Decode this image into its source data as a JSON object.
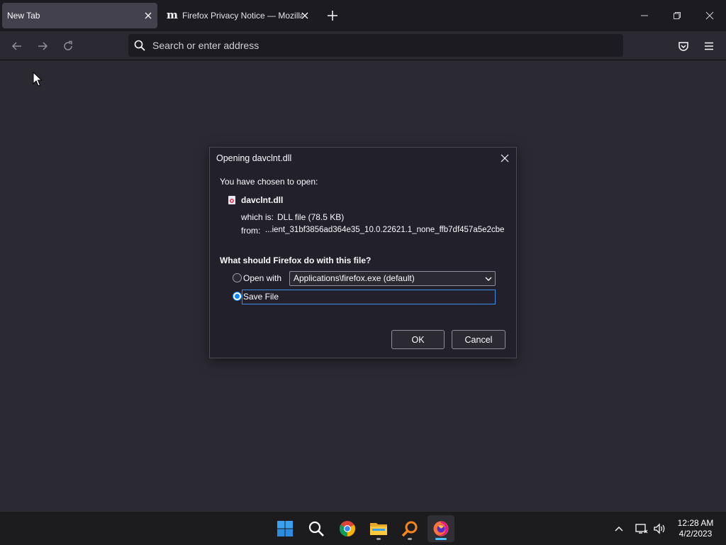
{
  "tabs": [
    {
      "label": "New Tab",
      "active": true
    },
    {
      "label": "Firefox Privacy Notice — Mozilla",
      "active": false,
      "favicon": "m"
    }
  ],
  "urlbar": {
    "placeholder": "Search or enter address"
  },
  "dialog": {
    "title": "Opening davclnt.dll",
    "chosen_text": "You have chosen to open:",
    "filename": "davclnt.dll",
    "which_is_label": "which is:",
    "which_is_value": "DLL file (78.5 KB)",
    "from_label": "from:",
    "from_value": "...ient_31bf3856ad364e35_10.0.22621.1_none_ffb7df457a5e2cbe",
    "question": "What should Firefox do with this file?",
    "open_with_label": "Open with",
    "open_with_app": "Applications\\firefox.exe (default)",
    "save_file_label": "Save File",
    "selected_option": "save_file",
    "ok_label": "OK",
    "cancel_label": "Cancel"
  },
  "taskbar": {
    "apps": [
      "windows-start",
      "search",
      "chrome",
      "file-explorer",
      "magnifier-app",
      "firefox"
    ],
    "time": "12:28 AM",
    "date": "4/2/2023"
  },
  "colors": {
    "accent": "#0a84ff",
    "dialog_bg": "#22212b",
    "content_bg": "#2b2a33"
  }
}
